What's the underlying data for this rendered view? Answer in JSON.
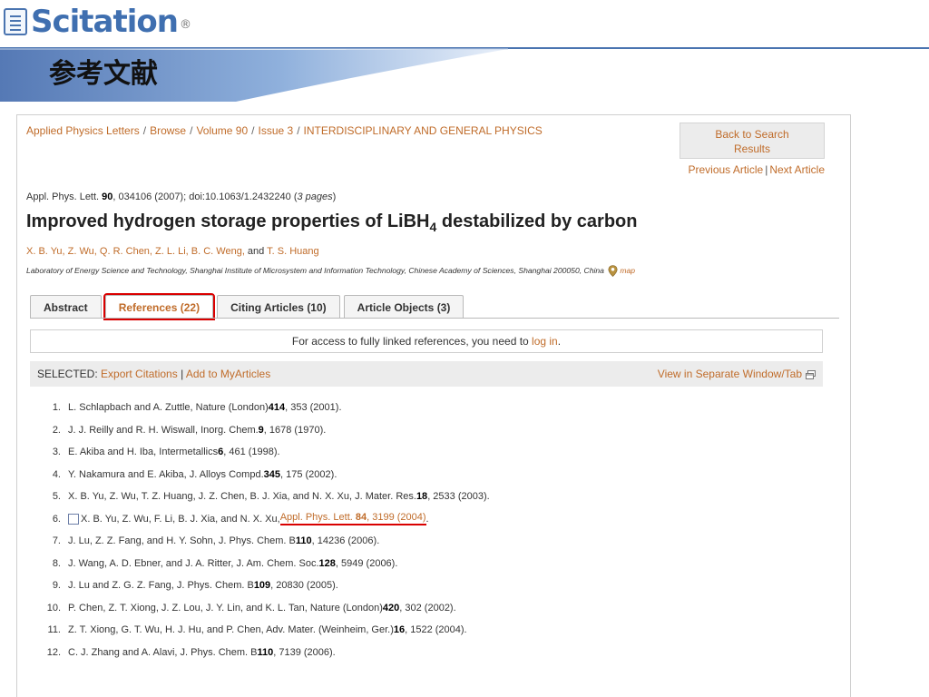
{
  "logo": {
    "text": "Scitation",
    "mark": "®"
  },
  "slide_title": "参考文献",
  "breadcrumb": [
    "Applied Physics Letters",
    "Browse",
    "Volume 90",
    "Issue 3",
    "INTERDISCIPLINARY AND GENERAL PHYSICS"
  ],
  "breadcrumb_sep": "/",
  "back_button": {
    "line1": "Back to Search",
    "line2": "Results"
  },
  "prevnext": {
    "prev": "Previous Article",
    "sep": "|",
    "next": "Next Article"
  },
  "citation": {
    "journal": "Appl. Phys. Lett.",
    "volume": "90",
    "rest": ", 034106 (2007); doi:10.1063/1.2432240 (",
    "pages": "3 pages",
    "close": ")"
  },
  "article_title": {
    "pre": "Improved hydrogen storage properties of LiBH",
    "sub": "4",
    "post": " destabilized by carbon"
  },
  "authors": {
    "list": "X. B. Yu, Z. Wu, Q. R. Chen, Z. L. Li, B. C. Weng,",
    "and": " and ",
    "last": "T. S. Huang"
  },
  "affiliation": {
    "text": "Laboratory of Energy Science and Technology, Shanghai Institute of Microsystem and Information Technology, Chinese Academy of Sciences, Shanghai 200050, China",
    "map": "map"
  },
  "tabs": [
    {
      "label": "Abstract"
    },
    {
      "label": "References (22)"
    },
    {
      "label": "Citing Articles (10)"
    },
    {
      "label": "Article Objects (3)"
    }
  ],
  "access": {
    "text": "For access to fully linked references, you need to ",
    "link": "log in",
    "end": "."
  },
  "selected_bar": {
    "label": "SELECTED: ",
    "export": "Export Citations",
    "sep": " | ",
    "add": "Add to MyArticles",
    "view": "View in Separate Window/Tab"
  },
  "references": [
    {
      "n": "1.",
      "pre": "L. Schlapbach and A. Zuttle, Nature (London) ",
      "vol": "414",
      "post": ", 353 (2001)."
    },
    {
      "n": "2.",
      "pre": "J. J. Reilly and R. H. Wiswall, Inorg. Chem. ",
      "vol": "9",
      "post": ", 1678 (1970)."
    },
    {
      "n": "3.",
      "pre": "E. Akiba and H. Iba, Intermetallics ",
      "vol": "6",
      "post": ", 461 (1998)."
    },
    {
      "n": "4.",
      "pre": "Y. Nakamura and E. Akiba, J. Alloys Compd. ",
      "vol": "345",
      "post": ", 175 (2002)."
    },
    {
      "n": "5.",
      "pre": "X. B. Yu, Z. Wu, T. Z. Huang, J. Z. Chen, B. J. Xia, and N. X. Xu, J. Mater. Res. ",
      "vol": "18",
      "post": ", 2533 (2003)."
    },
    {
      "n": "6.",
      "pre": "X. B. Yu, Z. Wu, F. Li, B. J. Xia, and N. X. Xu, ",
      "link_pre": "Appl. Phys. Lett. ",
      "vol": "84",
      "link_post": ", 3199 (2004)",
      "post": "."
    },
    {
      "n": "7.",
      "pre": "J. Lu, Z. Z. Fang, and H. Y. Sohn, J. Phys. Chem. B ",
      "vol": "110",
      "post": ", 14236 (2006)."
    },
    {
      "n": "8.",
      "pre": "J. Wang, A. D. Ebner, and J. A. Ritter, J. Am. Chem. Soc. ",
      "vol": "128",
      "post": ", 5949 (2006)."
    },
    {
      "n": "9.",
      "pre": "J. Lu and Z. G. Z. Fang, J. Phys. Chem. B ",
      "vol": "109",
      "post": ", 20830 (2005)."
    },
    {
      "n": "10.",
      "pre": "P. Chen, Z. T. Xiong, J. Z. Lou, J. Y. Lin, and K. L. Tan, Nature (London) ",
      "vol": "420",
      "post": ", 302 (2002)."
    },
    {
      "n": "11.",
      "pre": "Z. T. Xiong, G. T. Wu, H. J. Hu, and P. Chen, Adv. Mater. (Weinheim, Ger.) ",
      "vol": "16",
      "post": ", 1522 (2004)."
    },
    {
      "n": "12.",
      "pre": "C. J. Zhang and A. Alavi, J. Phys. Chem. B ",
      "vol": "110",
      "post": ", 7139 (2006)."
    }
  ],
  "colors": {
    "link": "#c06c2a",
    "highlight": "#d90000",
    "brand": "#3f6fb0",
    "band": "#4a74b0"
  }
}
